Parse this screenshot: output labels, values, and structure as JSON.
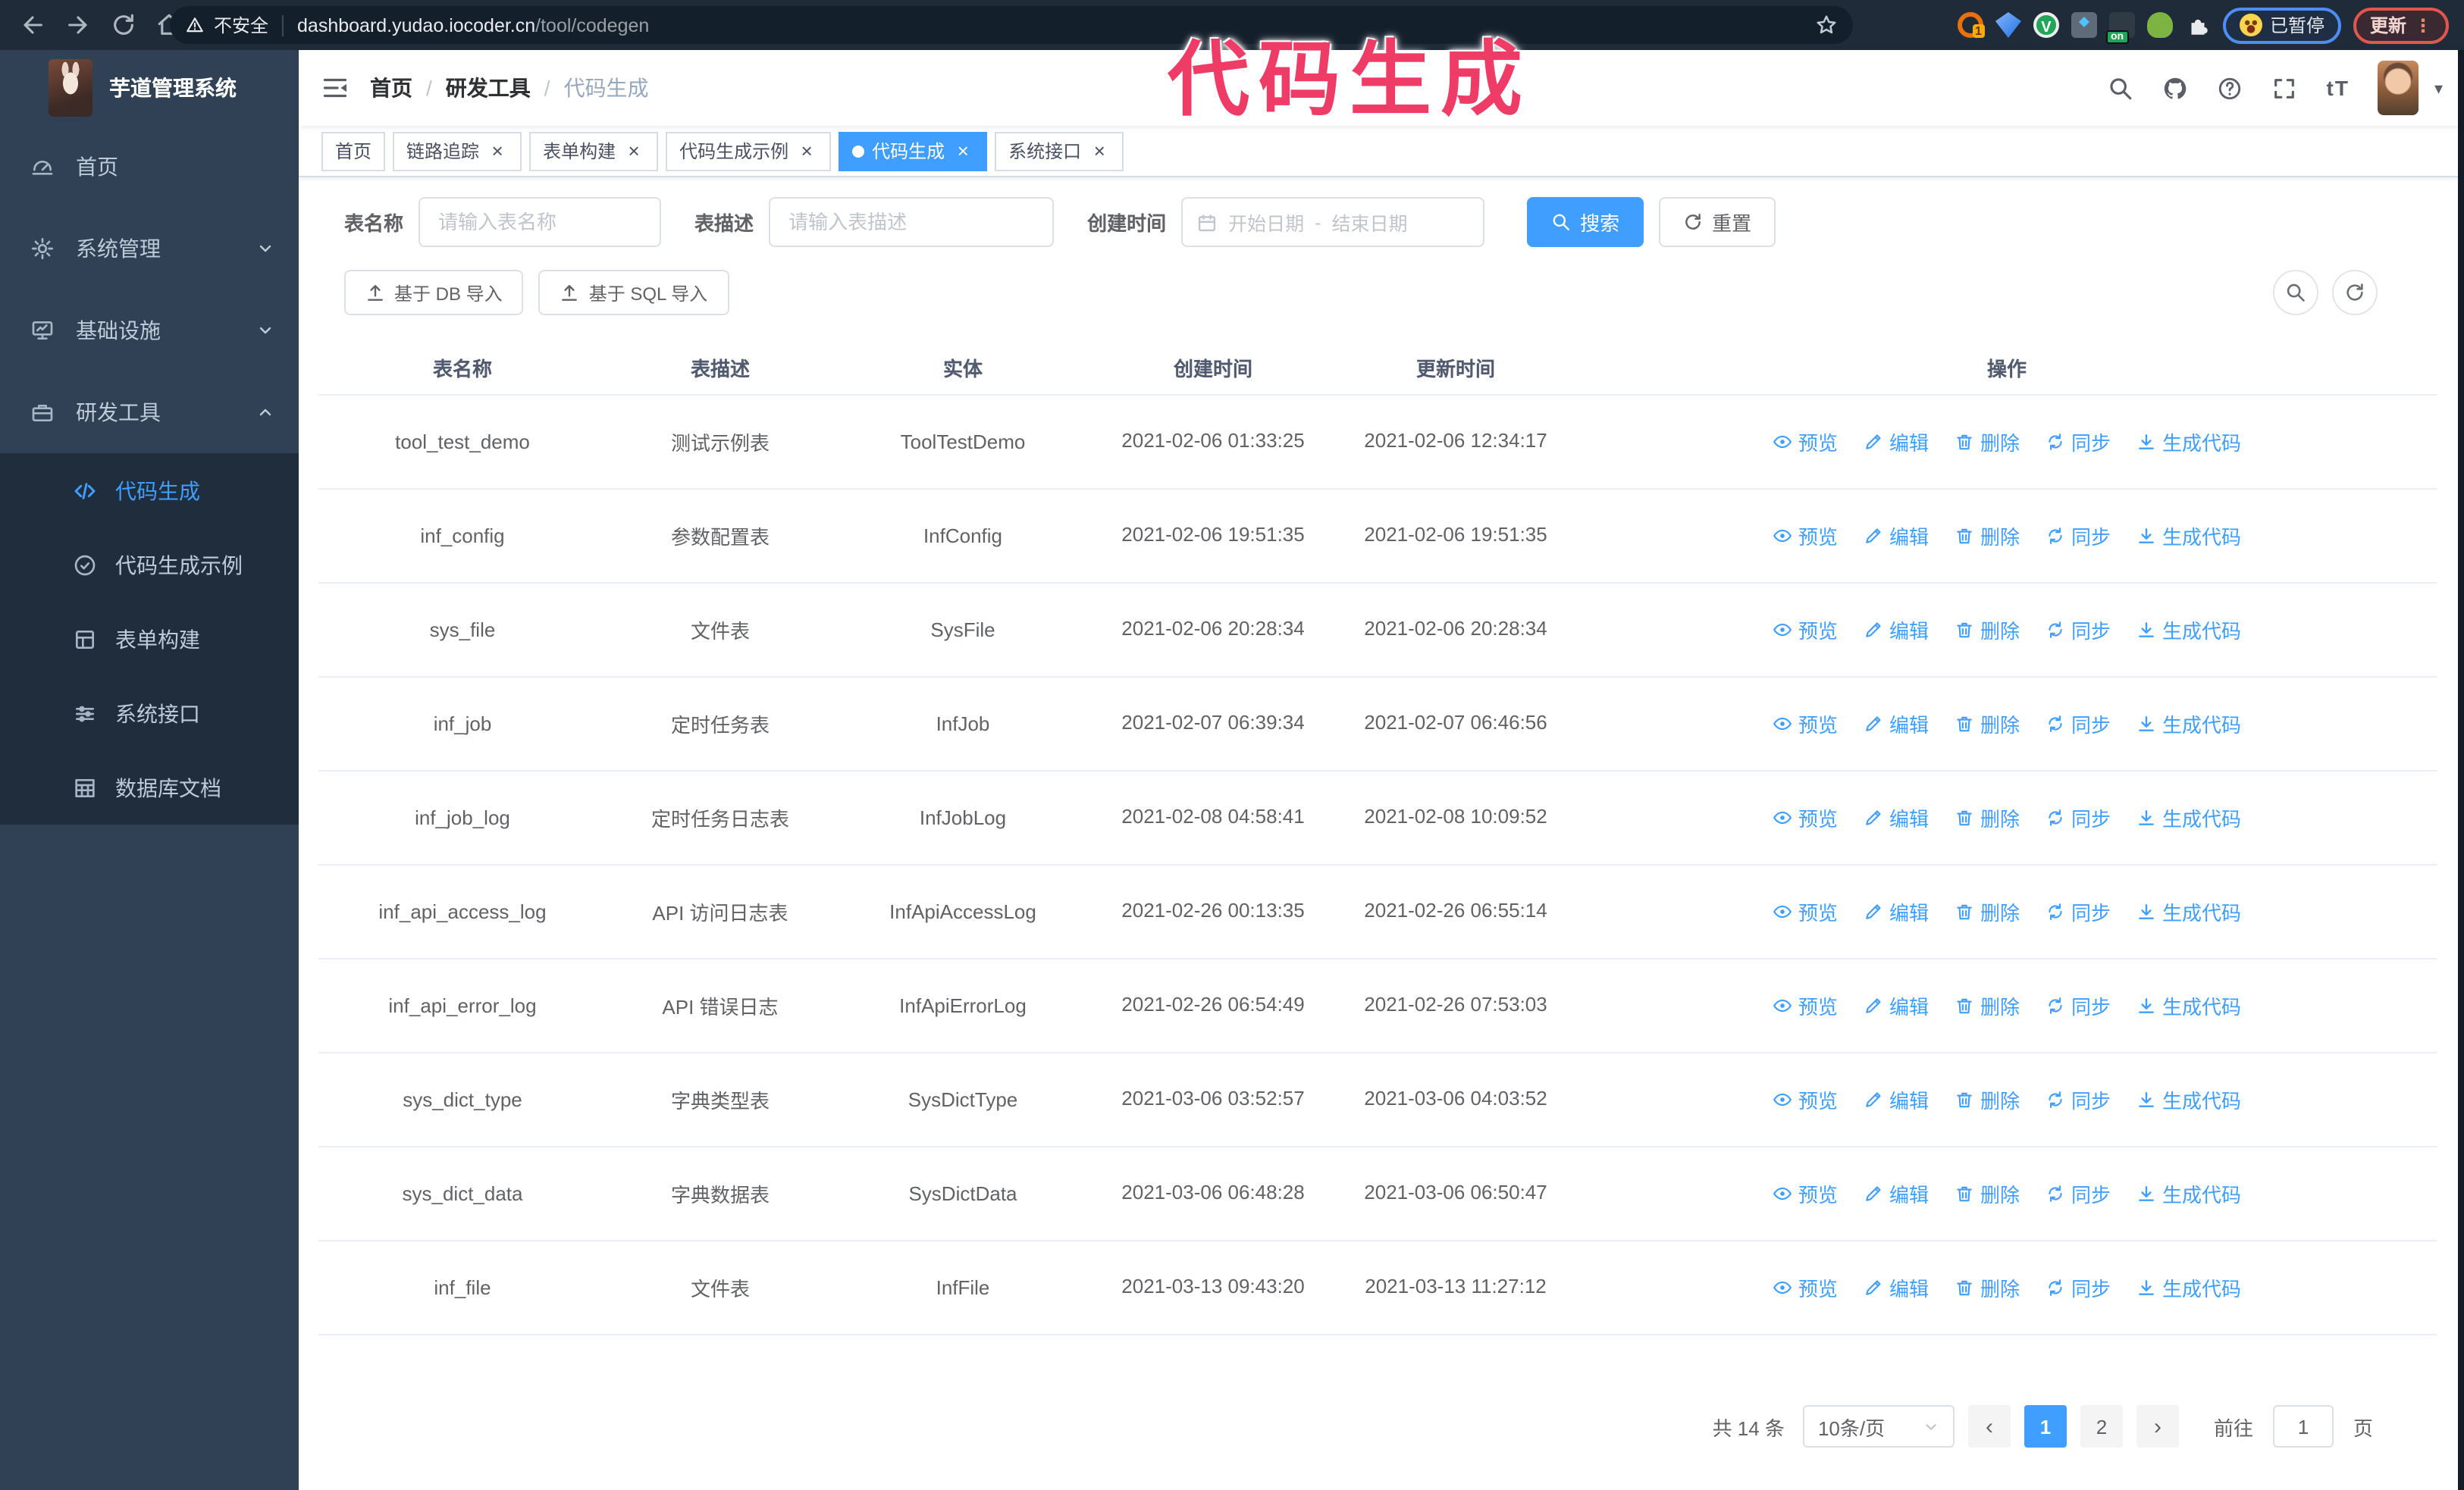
{
  "browser": {
    "security_label": "不安全",
    "url_host": "dashboard.yudao.iocoder.cn",
    "url_path": "/tool/codegen",
    "extension_badge": "1",
    "on_badge": "on",
    "paused_badge": "已暂停",
    "update_button": "更新",
    "menu_dots": "⋮"
  },
  "annotation": {
    "text": "代码生成",
    "color": "#ee3c66"
  },
  "sidebar": {
    "title": "芋道管理系统",
    "items": [
      {
        "label": "首页",
        "icon": "dashboard-icon",
        "arrow": "none"
      },
      {
        "label": "系统管理",
        "icon": "gear-icon",
        "arrow": "down"
      },
      {
        "label": "基础设施",
        "icon": "monitor-icon",
        "arrow": "down"
      },
      {
        "label": "研发工具",
        "icon": "toolbox-icon",
        "arrow": "up"
      }
    ],
    "subitems": [
      {
        "label": "代码生成",
        "icon": "code-icon",
        "active": true
      },
      {
        "label": "代码生成示例",
        "icon": "example-icon",
        "active": false
      },
      {
        "label": "表单构建",
        "icon": "form-icon",
        "active": false
      },
      {
        "label": "系统接口",
        "icon": "api-icon",
        "active": false
      },
      {
        "label": "数据库文档",
        "icon": "database-doc-icon",
        "active": false
      }
    ]
  },
  "navbar": {
    "breadcrumb": [
      "首页",
      "研发工具",
      "代码生成"
    ]
  },
  "tags": [
    {
      "label": "首页",
      "closable": false,
      "active": false
    },
    {
      "label": "链路追踪",
      "closable": true,
      "active": false
    },
    {
      "label": "表单构建",
      "closable": true,
      "active": false
    },
    {
      "label": "代码生成示例",
      "closable": true,
      "active": false
    },
    {
      "label": "代码生成",
      "closable": true,
      "active": true
    },
    {
      "label": "系统接口",
      "closable": true,
      "active": false
    }
  ],
  "search_form": {
    "table_name_label": "表名称",
    "table_name_placeholder": "请输入表名称",
    "table_desc_label": "表描述",
    "table_desc_placeholder": "请输入表描述",
    "create_time_label": "创建时间",
    "date_start_placeholder": "开始日期",
    "date_separator": "-",
    "date_end_placeholder": "结束日期",
    "search_button": "搜索",
    "reset_button": "重置"
  },
  "toolbar": {
    "import_db_button": "基于 DB 导入",
    "import_sql_button": "基于 SQL 导入"
  },
  "table": {
    "columns": [
      "表名称",
      "表描述",
      "实体",
      "创建时间",
      "更新时间",
      "操作"
    ],
    "actions": [
      "预览",
      "编辑",
      "删除",
      "同步",
      "生成代码"
    ],
    "rows": [
      {
        "name": "tool_test_demo",
        "desc": "测试示例表",
        "entity": "ToolTestDemo",
        "created": "2021-02-06 01:33:25",
        "updated": "2021-02-06 12:34:17"
      },
      {
        "name": "inf_config",
        "desc": "参数配置表",
        "entity": "InfConfig",
        "created": "2021-02-06 19:51:35",
        "updated": "2021-02-06 19:51:35"
      },
      {
        "name": "sys_file",
        "desc": "文件表",
        "entity": "SysFile",
        "created": "2021-02-06 20:28:34",
        "updated": "2021-02-06 20:28:34"
      },
      {
        "name": "inf_job",
        "desc": "定时任务表",
        "entity": "InfJob",
        "created": "2021-02-07 06:39:34",
        "updated": "2021-02-07 06:46:56"
      },
      {
        "name": "inf_job_log",
        "desc": "定时任务日志表",
        "entity": "InfJobLog",
        "created": "2021-02-08 04:58:41",
        "updated": "2021-02-08 10:09:52"
      },
      {
        "name": "inf_api_access_log",
        "desc": "API 访问日志表",
        "entity": "InfApiAccessLog",
        "created": "2021-02-26 00:13:35",
        "updated": "2021-02-26 06:55:14"
      },
      {
        "name": "inf_api_error_log",
        "desc": "API 错误日志",
        "entity": "InfApiErrorLog",
        "created": "2021-02-26 06:54:49",
        "updated": "2021-02-26 07:53:03"
      },
      {
        "name": "sys_dict_type",
        "desc": "字典类型表",
        "entity": "SysDictType",
        "created": "2021-03-06 03:52:57",
        "updated": "2021-03-06 04:03:52"
      },
      {
        "name": "sys_dict_data",
        "desc": "字典数据表",
        "entity": "SysDictData",
        "created": "2021-03-06 06:48:28",
        "updated": "2021-03-06 06:50:47"
      },
      {
        "name": "inf_file",
        "desc": "文件表",
        "entity": "InfFile",
        "created": "2021-03-13 09:43:20",
        "updated": "2021-03-13 11:27:12"
      }
    ]
  },
  "pagination": {
    "total_label": "共 14 条",
    "page_size": "10条/页",
    "prev_arrow": "‹",
    "next_arrow": "›",
    "pages": [
      "1",
      "2"
    ],
    "active_page": "1",
    "goto_label": "前往",
    "goto_value": "1",
    "page_label": "页"
  },
  "colors": {
    "accent": "#409eff",
    "sidebar_bg": "#304156",
    "submenu_bg": "#1f2d3d",
    "annotation": "#ee3c66",
    "chrome_bg": "#1f2b39",
    "link": "#409eff"
  }
}
